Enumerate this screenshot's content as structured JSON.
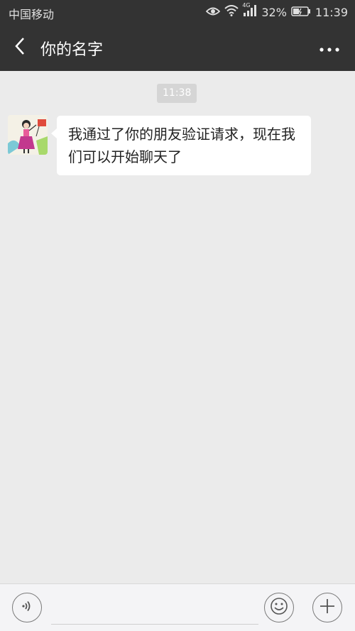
{
  "status_bar": {
    "carrier": "中国移动",
    "network_tag": "4G",
    "battery_percent": "32%",
    "clock": "11:39",
    "icons": [
      "eye-icon",
      "wifi-icon",
      "signal-icon",
      "battery-icon"
    ]
  },
  "header": {
    "title": "你的名字",
    "back_icon": "chevron-left-icon",
    "more_icon": "more-dots-icon"
  },
  "chat": {
    "timestamp": "11:38",
    "messages": [
      {
        "sender": "contact",
        "text": "我通过了你的朋友验证请求，现在我们可以开始聊天了"
      }
    ]
  },
  "input_bar": {
    "voice_icon": "voice-icon",
    "emoji_icon": "emoji-icon",
    "plus_icon": "plus-icon",
    "text_value": ""
  },
  "colors": {
    "header_bg": "#333333",
    "chat_bg": "#ebebeb",
    "bubble_bg": "#ffffff",
    "timestamp_bg": "#d5d5d5"
  }
}
